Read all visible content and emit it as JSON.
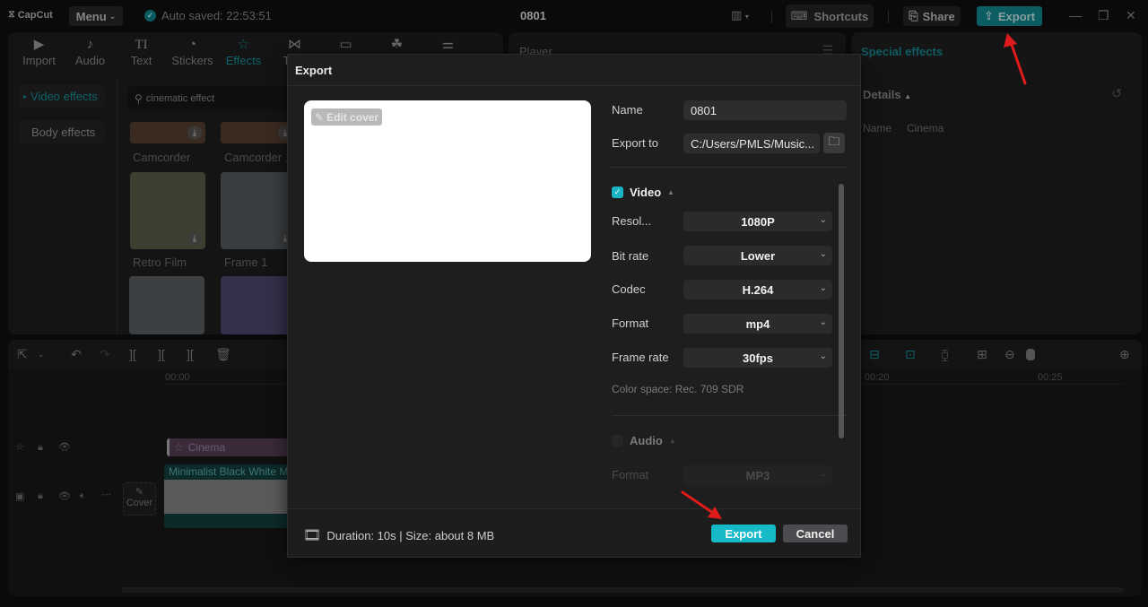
{
  "app": {
    "logo": "CapCut",
    "menu_label": "Menu",
    "autosave_text": "Auto saved: 22:53:51",
    "project_title": "0801",
    "shortcuts_label": "Shortcuts",
    "share_label": "Share",
    "export_label": "Export",
    "accent_color": "#16b9c8"
  },
  "left_panel": {
    "tabs": [
      {
        "label": "Import",
        "icon": "import-icon"
      },
      {
        "label": "Audio",
        "icon": "audio-icon"
      },
      {
        "label": "Text",
        "icon": "text-icon"
      },
      {
        "label": "Stickers",
        "icon": "stickers-icon"
      },
      {
        "label": "Effects",
        "icon": "effects-icon",
        "active": true
      },
      {
        "label": "Tran",
        "icon": "transitions-icon"
      }
    ],
    "categories": [
      {
        "label": "Video effects",
        "active": true
      },
      {
        "label": "Body effects"
      }
    ],
    "search_value": "cinematic effect",
    "effects": [
      {
        "label": "Camcorder"
      },
      {
        "label": "Camcorder 1"
      },
      {
        "label": "Retro Film"
      },
      {
        "label": "Frame 1"
      }
    ]
  },
  "player": {
    "title": "Player"
  },
  "right_panel": {
    "title": "Special effects",
    "details_label": "Details",
    "name_label": "Name",
    "name_value": "Cinema"
  },
  "timeline": {
    "ruler": [
      "00:00",
      "00:20",
      "00:25"
    ],
    "effect_clip": "Cinema",
    "video_clip": "Minimalist Black White M",
    "cover_label": "Cover"
  },
  "export_dialog": {
    "title": "Export",
    "edit_cover_label": "Edit cover",
    "name_label": "Name",
    "name_value": "0801",
    "export_to_label": "Export to",
    "export_to_value": "C:/Users/PMLS/Music...",
    "video": {
      "label": "Video",
      "checked": true,
      "resolution_label": "Resol...",
      "resolution_value": "1080P",
      "bitrate_label": "Bit rate",
      "bitrate_value": "Lower",
      "codec_label": "Codec",
      "codec_value": "H.264",
      "format_label": "Format",
      "format_value": "mp4",
      "framerate_label": "Frame rate",
      "framerate_value": "30fps",
      "color_space": "Color space: Rec. 709 SDR"
    },
    "audio": {
      "label": "Audio",
      "checked": false,
      "format_label": "Format",
      "format_value": "MP3"
    },
    "footer_info": "Duration: 10s | Size: about 8 MB",
    "export_button": "Export",
    "cancel_button": "Cancel"
  }
}
